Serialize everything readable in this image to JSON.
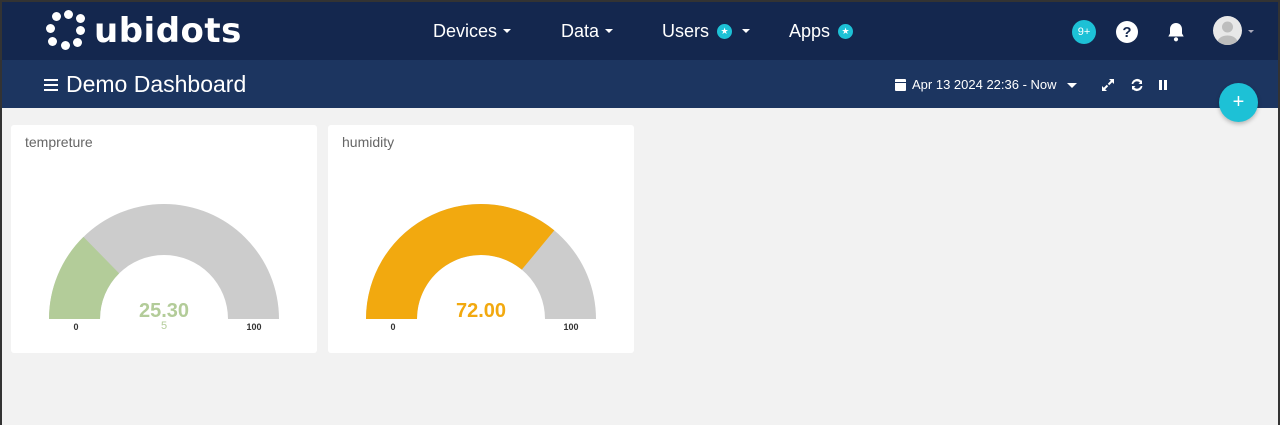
{
  "brand": {
    "name": "ubidots"
  },
  "nav": {
    "devices": "Devices",
    "data": "Data",
    "users": "Users",
    "apps": "Apps",
    "notifications_count": "9+"
  },
  "header": {
    "title": "Demo Dashboard",
    "date_range": "Apr 13 2024 22:36 - Now"
  },
  "widgets": [
    {
      "title": "tempreture",
      "value_label": "25.30",
      "value": 25.3,
      "min_label": "0",
      "max_label": "100",
      "min": 0,
      "max": 100,
      "extra_label": "5",
      "color": "#b3cc99"
    },
    {
      "title": "humidity",
      "value_label": "72.00",
      "value": 72,
      "min_label": "0",
      "max_label": "100",
      "min": 0,
      "max": 100,
      "color": "#f2a90f"
    }
  ],
  "colors": {
    "topbar": "#14274e",
    "subbar": "#1c3560",
    "accent": "#1dc1d6",
    "gauge_track": "#cccccc"
  }
}
